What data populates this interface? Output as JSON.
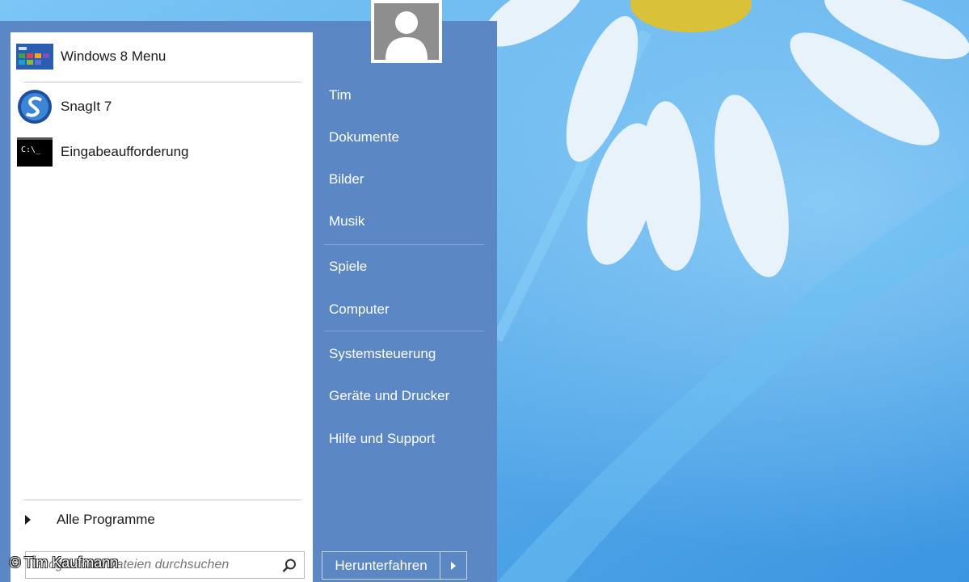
{
  "user": {
    "avatar_icon": "user-avatar-icon"
  },
  "programs": [
    {
      "label": "Windows 8 Menu",
      "icon": "windows8-menu-icon"
    },
    {
      "label": "SnagIt 7",
      "icon": "snagit-icon"
    },
    {
      "label": "Eingabeaufforderung",
      "icon": "command-prompt-icon",
      "icon_text": "C:\\_"
    }
  ],
  "all_programs": {
    "label": "Alle Programme"
  },
  "search": {
    "placeholder": "Programme/Dateien durchsuchen"
  },
  "right_links": [
    "Tim",
    "Dokumente",
    "Bilder",
    "Musik",
    "Spiele",
    "Computer",
    "Systemsteuerung",
    "Geräte und Drucker",
    "Hilfe und Support"
  ],
  "shutdown": {
    "label": "Herunterfahren"
  },
  "copyright": "© Tim Kaufmann",
  "colors": {
    "menu_blue": "#5b87c4",
    "desktop_blue": "#4aa3e8"
  }
}
